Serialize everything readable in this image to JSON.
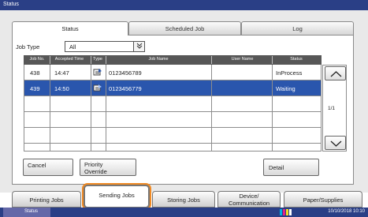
{
  "window": {
    "title": "Status"
  },
  "tabs": [
    {
      "label": "Status",
      "active": true
    },
    {
      "label": "Scheduled Job",
      "active": false
    },
    {
      "label": "Log",
      "active": false
    }
  ],
  "filter": {
    "label": "Job Type",
    "value": "All",
    "dropdown_icon": "double-chevron-down-icon"
  },
  "table": {
    "headers": [
      "Job No.",
      "Accepted Time",
      "Type",
      "Job Name",
      "User Name",
      "Status"
    ],
    "rows": [
      {
        "job_no": "438",
        "time": "14:47",
        "type_icon": "send-job-icon",
        "name": "0123456789",
        "user": "",
        "status": "InProcess",
        "selected": false
      },
      {
        "job_no": "439",
        "time": "14:50",
        "type_icon": "send-job-icon",
        "name": "0123456779",
        "user": "",
        "status": "Waiting",
        "selected": true
      }
    ],
    "empty_rows": 3
  },
  "pager": {
    "text": "1/1",
    "up_icon": "chevron-up-icon",
    "down_icon": "chevron-down-icon"
  },
  "buttons": {
    "cancel": "Cancel",
    "priority_line1": "Priority",
    "priority_line2": "Override",
    "detail": "Detail"
  },
  "bottom_tabs": [
    {
      "label": "Printing Jobs"
    },
    {
      "label": "Sending Jobs",
      "highlighted": true
    },
    {
      "label": "Storing Jobs"
    },
    {
      "label_line1": "Device/",
      "label_line2": "Communication"
    },
    {
      "label": "Paper/Supplies"
    }
  ],
  "status_bar": {
    "label": "Status",
    "datetime": "10/10/2018  10:10",
    "toner_icon": "toner-level-icon"
  },
  "colors": {
    "header_blue": "#2a3f86",
    "selected_row": "#2a56ad",
    "highlight_ring": "#f08a24",
    "table_header": "#575757"
  }
}
